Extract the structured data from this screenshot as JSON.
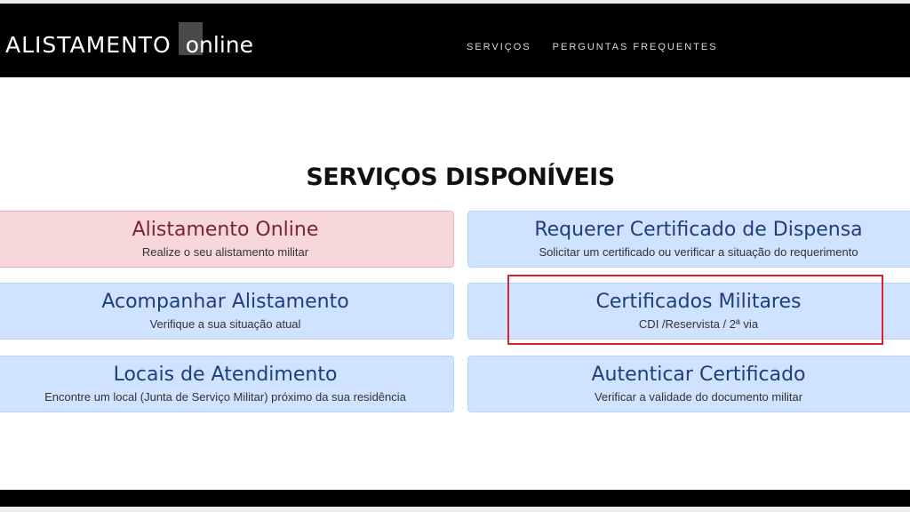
{
  "navbar": {
    "brand_main": "ALISTAMENTO",
    "brand_online": "online",
    "links": [
      "SERVIÇOS",
      "PERGUNTAS FREQUENTES"
    ]
  },
  "main": {
    "title": "SERVIÇOS DISPONÍVEIS",
    "cards": [
      {
        "title": "Alistamento Online",
        "subtitle": "Realize o seu alistamento militar"
      },
      {
        "title": "Requerer Certificado de Dispensa",
        "subtitle": "Solicitar um certificado ou verificar a situação do requerimento"
      },
      {
        "title": "Acompanhar Alistamento",
        "subtitle": "Verifique a sua situação atual"
      },
      {
        "title": "Certificados Militares",
        "subtitle": "CDI /Reservista / 2ª via"
      },
      {
        "title": "Locais de Atendimento",
        "subtitle": "Encontre um local (Junta de Serviço Militar) próximo da sua residência"
      },
      {
        "title": "Autenticar Certificado",
        "subtitle": "Verificar a validade do documento militar"
      }
    ]
  },
  "colors": {
    "card_blue": "#cfe2ff",
    "card_red": "#f8d7da",
    "highlight": "#d9262b",
    "navbar": "#000000"
  }
}
